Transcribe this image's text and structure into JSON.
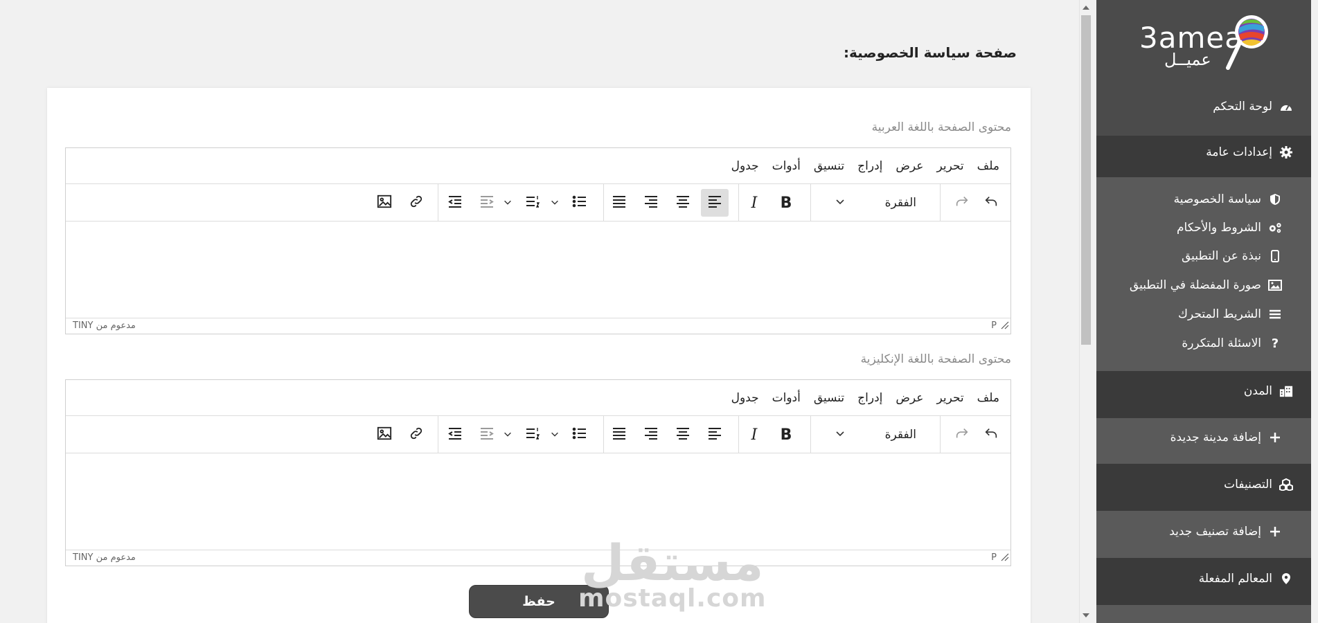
{
  "app": {
    "logo_word": "3ameal",
    "logo_arabic": "عميــل",
    "brand_colors": {
      "sidebar": "#4b4b4b",
      "sidebar_dark": "#3a3a3a",
      "accent": "#ffffff"
    }
  },
  "sidebar": {
    "dashboard": "لوحة التحكم",
    "general_settings": "إعدادات عامة",
    "privacy_policy": "سياسة الخصوصية",
    "terms": "الشروط والأحكام",
    "about_app": "نبذة عن التطبيق",
    "favorite_image": "صورة المفضلة في التطبيق",
    "slider": "الشريط المتحرك",
    "faq": "الاسئلة المتكررة",
    "cities": "المدن",
    "add_city": "إضافة مدينة جديدة",
    "categories": "التصنيفات",
    "add_category": "إضافة تصنيف جديد",
    "landmarks": "المعالم المفعلة"
  },
  "main": {
    "page_title": "صفحة سياسة الخصوصية:",
    "arabic_label": "محتوى الصفحة باللغة العربية",
    "english_label": "محتوى الصفحة باللغة الإنكليزية",
    "save_label": "حفظ"
  },
  "editor": {
    "menu": {
      "file": "ملف",
      "edit": "تحرير",
      "view": "عرض",
      "insert": "إدراج",
      "format": "تنسيق",
      "tools": "أدوات",
      "table": "جدول"
    },
    "paragraph": "الفقرة",
    "bold_glyph": "B",
    "italic_glyph": "I",
    "status_path": "P",
    "powered_by": "مدعوم من TINY"
  },
  "watermark": {
    "arabic": "مستقل",
    "latin": "mostaql.com"
  },
  "icons": {
    "undo": "undo-icon",
    "redo": "redo-icon",
    "align": "align-icon",
    "list": "list-icon",
    "link": "link-icon",
    "image": "image-icon"
  }
}
